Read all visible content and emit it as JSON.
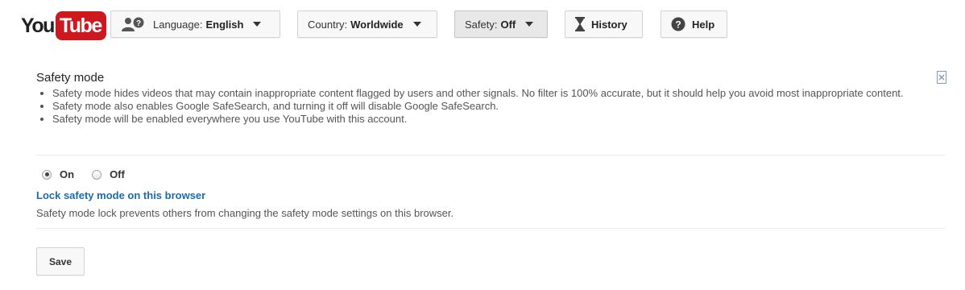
{
  "logo": {
    "you": "You",
    "tube": "Tube",
    "accent": "#cc181e"
  },
  "toolbar": {
    "language": {
      "label": "Language:",
      "value": "English",
      "icon": "people-help-icon"
    },
    "country": {
      "label": "Country:",
      "value": "Worldwide"
    },
    "safety": {
      "label": "Safety:",
      "value": "Off"
    },
    "history": {
      "label": "History",
      "icon": "hourglass-icon"
    },
    "help": {
      "label": "Help",
      "icon": "question-circle-icon"
    }
  },
  "safety_panel": {
    "title": "Safety mode",
    "bullets": [
      "Safety mode hides videos that may contain inappropriate content flagged by users and other signals. No filter is 100% accurate, but it should help you avoid most inappropriate content.",
      "Safety mode also enables Google SafeSearch, and turning it off will disable Google SafeSearch.",
      "Safety mode will be enabled everywhere you use YouTube with this account."
    ],
    "options": [
      {
        "label": "On",
        "checked": true
      },
      {
        "label": "Off",
        "checked": false
      }
    ],
    "lock_link": "Lock safety mode on this browser",
    "lock_description": "Safety mode lock prevents others from changing the safety mode settings on this browser.",
    "save_label": "Save"
  },
  "colors": {
    "link": "#1b6cab",
    "text": "#555555"
  }
}
